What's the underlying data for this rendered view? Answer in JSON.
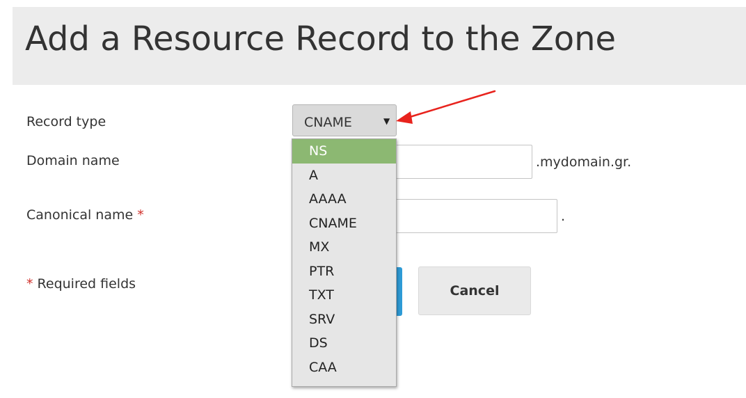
{
  "header": {
    "title": "Add a Resource Record to the Zone"
  },
  "form": {
    "record_type": {
      "label": "Record type",
      "selected": "CNAME",
      "caret": "▼",
      "options": [
        "NS",
        "A",
        "AAAA",
        "CNAME",
        "MX",
        "PTR",
        "TXT",
        "SRV",
        "DS",
        "CAA"
      ],
      "highlighted_option": "NS"
    },
    "domain_name": {
      "label": "Domain name",
      "value": "",
      "suffix": ".mydomain.gr."
    },
    "canonical_name": {
      "label": "Canonical name",
      "required_mark": "*",
      "value": "",
      "suffix": "."
    },
    "required_note": {
      "mark": "*",
      "text": "Required fields"
    }
  },
  "buttons": {
    "cancel_label": "Cancel"
  },
  "colors": {
    "header_background": "#ececec",
    "required_star": "#d0302a",
    "highlight": "#8cb872",
    "primary_button": "#2e9bd6",
    "annotation_arrow": "#e8231d"
  },
  "icons": {
    "caret": "triangle-down-icon",
    "annotation": "red-arrow-icon"
  }
}
